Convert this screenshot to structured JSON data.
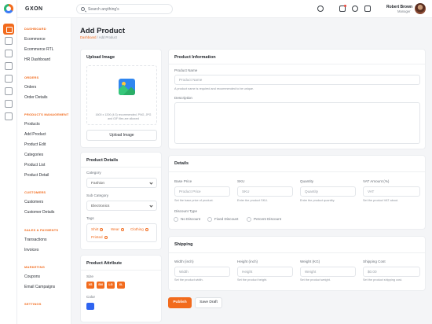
{
  "brand": "GXON",
  "search": {
    "placeholder": "Search anything's"
  },
  "user": {
    "name": "Robert Brown",
    "role": "Manager"
  },
  "sidebar": {
    "sections": [
      {
        "title": "DASHBOARD",
        "items": [
          "Ecommerce",
          "Ecommerce RTL",
          "HR Dashboard"
        ]
      },
      {
        "title": "ORDERS",
        "items": [
          "Orders",
          "Order Details"
        ]
      },
      {
        "title": "PRODUCTS MANAGEMENT",
        "items": [
          "Products",
          "Add Product",
          "Product Edit",
          "Categories",
          "Product List",
          "Product Detail"
        ]
      },
      {
        "title": "CUSTOMERS",
        "items": [
          "Customers",
          "Customer Details"
        ]
      },
      {
        "title": "SALES & PAYMENTS",
        "items": [
          "Transactions",
          "Invoices"
        ]
      },
      {
        "title": "MARKETING",
        "items": [
          "Coupons",
          "Email Campaigns"
        ]
      },
      {
        "title": "SETTINGS",
        "items": []
      }
    ]
  },
  "page": {
    "title": "Add Product",
    "breadcrumb": [
      "Dashboard",
      "/",
      "Add Product"
    ]
  },
  "upload": {
    "title": "Upload Image",
    "help": "1600 x 1200 (4:3) recommended. PNG, JPG and GIF files are allowed",
    "button": "Upload Image"
  },
  "product_details": {
    "title": "Product Details",
    "category_label": "Category",
    "category_value": "Fashion",
    "subcategory_label": "Sub Category",
    "subcategory_value": "Electronics",
    "tags_label": "Tags",
    "tags": [
      "Shirt",
      "Wear",
      "Clothing",
      "Printed"
    ]
  },
  "product_attribute": {
    "title": "Product Attribute",
    "size_label": "Size",
    "sizes": [
      "XS",
      "SM",
      "LG",
      "XL"
    ],
    "color_label": "Color",
    "color": "#2f64f0"
  },
  "product_info": {
    "title": "Product Information",
    "name_label": "Product Name",
    "name_placeholder": "Product Name",
    "name_hint": "A product name is required and recommended to be unique.",
    "description_label": "Description"
  },
  "details": {
    "title": "Details",
    "base_price_label": "Base Price",
    "base_price_placeholder": "Product Price",
    "base_price_hint": "Set the base price of product.",
    "sku_label": "SKU",
    "sku_placeholder": "SKU",
    "sku_hint": "Enter the product SKU.",
    "quantity_label": "Quantity",
    "quantity_placeholder": "Quantity",
    "quantity_hint": "Enter the product quantity.",
    "vat_label": "VAT Amount (%)",
    "vat_placeholder": "VAT",
    "vat_hint": "Set the product VAT about.",
    "discount_label": "Discount Type",
    "discount_options": [
      "No Discount",
      "Fixed Discount",
      "Percent Discount"
    ]
  },
  "shipping": {
    "title": "Shipping",
    "width_label": "Width (inch)",
    "width_placeholder": "Width",
    "width_hint": "Set the product width.",
    "height_label": "Height (inch)",
    "height_placeholder": "Height",
    "height_hint": "Set the product height.",
    "weight_label": "Weight (KG)",
    "weight_placeholder": "Weight",
    "weight_hint": "Set the product weight.",
    "cost_label": "Shipping Cost",
    "cost_placeholder": "$0.00",
    "cost_hint": "Set the product shipping cost."
  },
  "actions": {
    "publish": "Publish",
    "save_draft": "Save Draft"
  },
  "colors": {
    "accent": "#f26b1d",
    "text": "#1f2329",
    "muted": "#6b717a"
  }
}
